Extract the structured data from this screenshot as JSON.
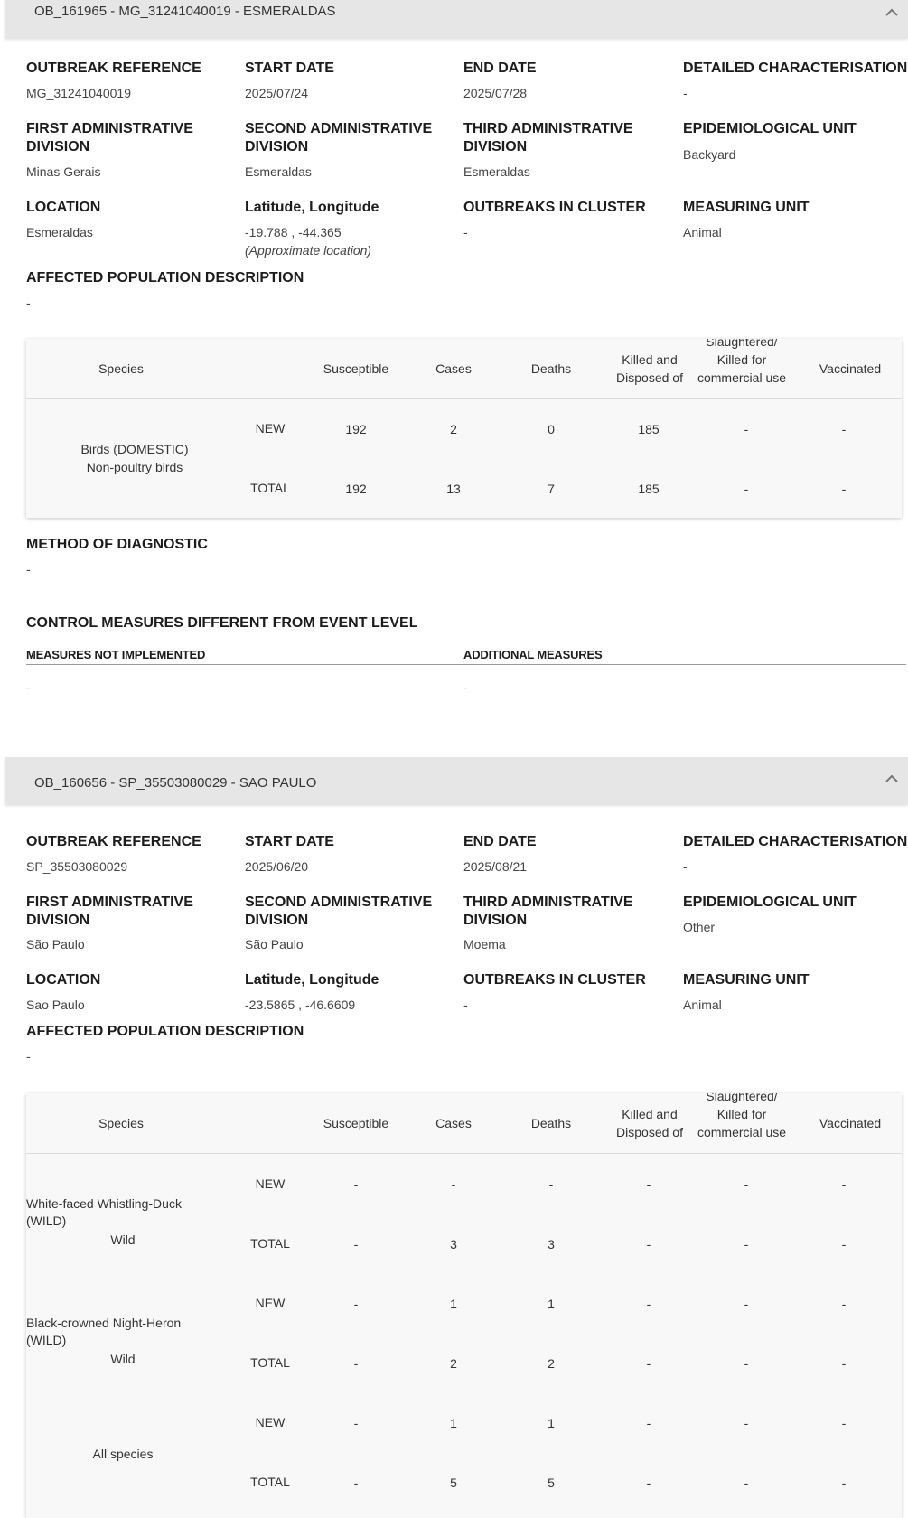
{
  "outbreaks": [
    {
      "header": "OB_161965 - MG_31241040019 - ESMERALDAS",
      "fields": {
        "outbreak_reference": {
          "label": "OUTBREAK REFERENCE",
          "value": "MG_31241040019"
        },
        "start_date": {
          "label": "START DATE",
          "value": "2025/07/24"
        },
        "end_date": {
          "label": "END DATE",
          "value": "2025/07/28"
        },
        "detailed_characterisation": {
          "label": "DETAILED CHARACTERISATION",
          "value": "-"
        },
        "first_admin": {
          "label1": "FIRST ADMINISTRATIVE",
          "label2": "DIVISION",
          "value": "Minas Gerais"
        },
        "second_admin": {
          "label1": "SECOND ADMINISTRATIVE",
          "label2": "DIVISION",
          "value": "Esmeraldas"
        },
        "third_admin": {
          "label1": "THIRD ADMINISTRATIVE",
          "label2": "DIVISION",
          "value": "Esmeraldas"
        },
        "epi_unit": {
          "label": "EPIDEMIOLOGICAL UNIT",
          "value": "Backyard"
        },
        "location": {
          "label": "LOCATION",
          "value": "Esmeraldas"
        },
        "latlon": {
          "label": "Latitude, Longitude",
          "value": "-19.788 , -44.365",
          "note": "(Approximate location)"
        },
        "outbreaks_in_cluster": {
          "label": "OUTBREAKS IN CLUSTER",
          "value": "-"
        },
        "measuring_unit": {
          "label": "MEASURING UNIT",
          "value": "Animal"
        },
        "affected_population": {
          "label": "AFFECTED POPULATION DESCRIPTION",
          "value": "-"
        }
      },
      "table": {
        "species_header": "Species",
        "headers": [
          "Susceptible",
          "Cases",
          "Deaths",
          "Killed and Disposed of",
          "Slaughtered/ Killed for commercial use",
          "Vaccinated"
        ],
        "rows": [
          {
            "species": "Birds (DOMESTIC) Non-poultry birds",
            "new_label": "NEW",
            "new": [
              "192",
              "2",
              "0",
              "185",
              "-",
              "-"
            ],
            "total_label": "TOTAL",
            "total": [
              "192",
              "13",
              "7",
              "185",
              "-",
              "-"
            ]
          }
        ]
      },
      "diagnostic": {
        "label": "METHOD OF DIAGNOSTIC",
        "value": "-"
      },
      "control": {
        "label": "CONTROL MEASURES DIFFERENT FROM EVENT LEVEL",
        "not_implemented_label": "MEASURES NOT IMPLEMENTED",
        "not_implemented_value": "-",
        "additional_label": "ADDITIONAL MEASURES",
        "additional_value": "-"
      }
    },
    {
      "header": "OB_160656 - SP_35503080029 - SAO PAULO",
      "fields": {
        "outbreak_reference": {
          "label": "OUTBREAK REFERENCE",
          "value": "SP_35503080029"
        },
        "start_date": {
          "label": "START DATE",
          "value": "2025/06/20"
        },
        "end_date": {
          "label": "END DATE",
          "value": "2025/08/21"
        },
        "detailed_characterisation": {
          "label": "DETAILED CHARACTERISATION",
          "value": "-"
        },
        "first_admin": {
          "label1": "FIRST ADMINISTRATIVE",
          "label2": "DIVISION",
          "value": "São Paulo"
        },
        "second_admin": {
          "label1": "SECOND ADMINISTRATIVE",
          "label2": "DIVISION",
          "value": "São Paulo"
        },
        "third_admin": {
          "label1": "THIRD ADMINISTRATIVE",
          "label2": "DIVISION",
          "value": "Moema"
        },
        "epi_unit": {
          "label": "EPIDEMIOLOGICAL UNIT",
          "value": "Other"
        },
        "location": {
          "label": "LOCATION",
          "value": "Sao Paulo"
        },
        "latlon": {
          "label": "Latitude, Longitude",
          "value": "-23.5865 , -46.6609"
        },
        "outbreaks_in_cluster": {
          "label": "OUTBREAKS IN CLUSTER",
          "value": "-"
        },
        "measuring_unit": {
          "label": "MEASURING UNIT",
          "value": "Animal"
        },
        "affected_population": {
          "label": "AFFECTED POPULATION DESCRIPTION",
          "value": "-"
        }
      },
      "table": {
        "species_header": "Species",
        "headers": [
          "Susceptible",
          "Cases",
          "Deaths",
          "Killed and Disposed of",
          "Slaughtered/ Killed for commercial use",
          "Vaccinated"
        ],
        "rows": [
          {
            "species_line1": "White-faced Whistling-Duck",
            "species_line2": "(WILD)",
            "species_line3": "Wild",
            "new_label": "NEW",
            "new": [
              "-",
              "-",
              "-",
              "-",
              "-",
              "-"
            ],
            "total_label": "TOTAL",
            "total": [
              "-",
              "3",
              "3",
              "-",
              "-",
              "-"
            ]
          },
          {
            "species_line1": "Black-crowned Night-Heron",
            "species_line2": "(WILD)",
            "species_line3": "Wild",
            "new_label": "NEW",
            "new": [
              "-",
              "1",
              "1",
              "-",
              "-",
              "-"
            ],
            "total_label": "TOTAL",
            "total": [
              "-",
              "2",
              "2",
              "-",
              "-",
              "-"
            ]
          },
          {
            "species_line3": "All species",
            "new_label": "NEW",
            "new": [
              "-",
              "1",
              "1",
              "-",
              "-",
              "-"
            ],
            "total_label": "TOTAL",
            "total": [
              "-",
              "5",
              "5",
              "-",
              "-",
              "-"
            ]
          }
        ]
      }
    }
  ],
  "icons": {
    "collapse": "chevron-up-icon"
  }
}
